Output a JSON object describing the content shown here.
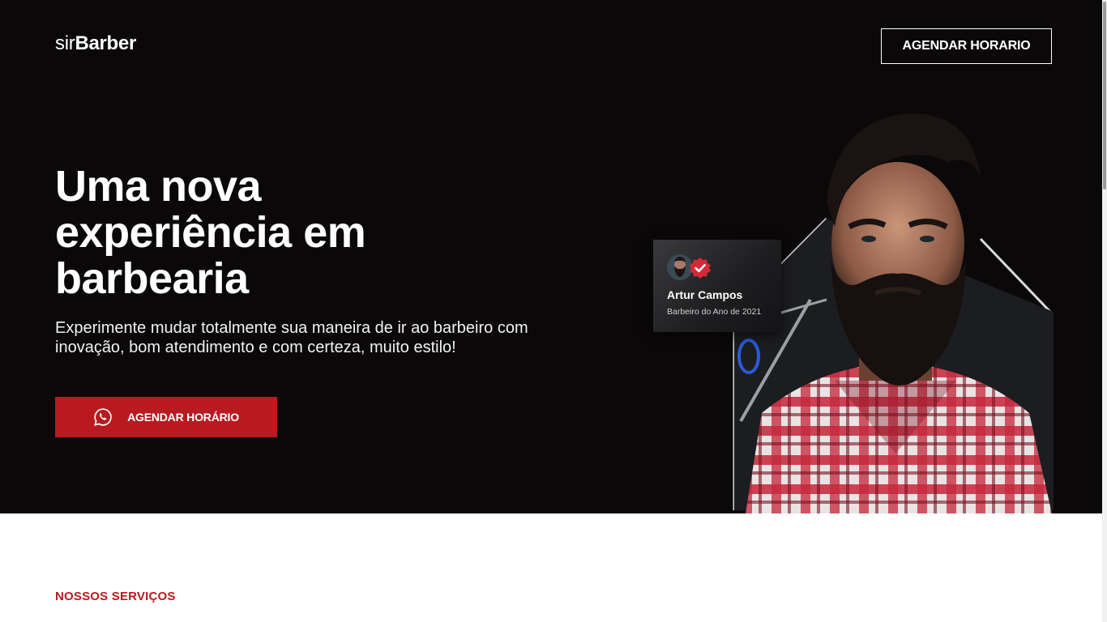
{
  "brand": {
    "prefix": "sir",
    "name": "Barber"
  },
  "header": {
    "cta_label": "AGENDAR HORARIO"
  },
  "hero": {
    "headline_lines": [
      "Uma nova",
      "experiência em",
      "barbearia"
    ],
    "subtitle": "Experimente mudar totalmente sua maneira de ir ao barbeiro com inovação, bom atendimento e com certeza, muito estilo!",
    "cta_label": "AGENDAR HORÁRIO",
    "cta_icon": "whatsapp-icon"
  },
  "barber_badge": {
    "name": "Artur Campos",
    "title": "Barbeiro do Ano de 2021",
    "verified_icon": "check-badge-icon"
  },
  "services": {
    "eyebrow": "NOSSOS SERVIÇOS"
  },
  "colors": {
    "hero_bg": "#0b0809",
    "accent": "#b81a1f",
    "text_light": "#ffffff"
  }
}
